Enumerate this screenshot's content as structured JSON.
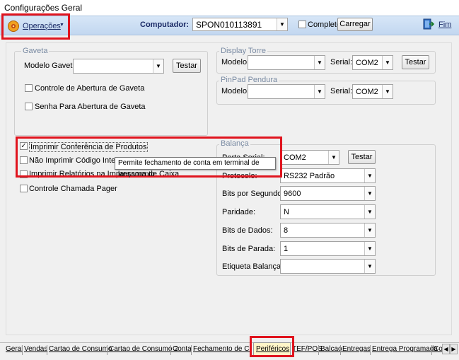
{
  "window": {
    "title": "Configurações Geral"
  },
  "toolbar": {
    "operations_label": "Operações",
    "computer_label": "Computador:",
    "computer_value": "SPON010113891",
    "complete_label": "Completo",
    "load_button": "Carregar",
    "exit_label": "Fim"
  },
  "gaveta": {
    "title": "Gaveta",
    "model_label": "Modelo Gaveta:",
    "model_value": "",
    "test_button": "Testar",
    "opening_control_label": "Controle de Abertura de Gaveta",
    "password_label": "Senha Para Abertura de Gaveta"
  },
  "display_torre": {
    "title": "Display Torre",
    "model_label": "Modelo:",
    "model_value": "",
    "serial_label": "Serial:",
    "serial_value": "COM2",
    "test_button": "Testar"
  },
  "pinpad": {
    "title": "PinPad Pendura",
    "model_label": "Modelo:",
    "model_value": "",
    "serial_label": "Serial:",
    "serial_value": "COM2"
  },
  "options": {
    "print_products_label": "Imprimir Conferência de Produtos",
    "print_products_checked": true,
    "no_internal_code_label": "Não Imprimir Código Interno no",
    "print_reports_label": "Imprimir Relatórios na Impressora de Caixa",
    "pager_label": "Controle Chamada Pager"
  },
  "tooltip": {
    "text": "Permite fechamento de conta em terminal de lançamento"
  },
  "balanca": {
    "title": "Balança",
    "serial_port_label": "Porta Serial:",
    "serial_port_value": "COM2",
    "test_button": "Testar",
    "protocol_label": "Protocolo:",
    "protocol_value": "RS232 Padrão",
    "bps_label": "Bits por Segundo:",
    "bps_value": "9600",
    "parity_label": "Paridade:",
    "parity_value": "N",
    "data_bits_label": "Bits de Dados:",
    "data_bits_value": "8",
    "stop_bits_label": "Bits de Parada:",
    "stop_bits_value": "1",
    "label_label": "Etiqueta Balança:",
    "label_value": ""
  },
  "tabs": [
    "Geral",
    "Vendas",
    "Cartao de Consumo",
    "Cartao de Consumo 2",
    "Conta",
    "Fechamento de Caixa",
    "Periféricos",
    "TEF/POS",
    "Balcao",
    "Entregas",
    "Entrega Programada",
    "Co"
  ],
  "active_tab": "Periféricos",
  "colors": {
    "highlight": "#e0141e",
    "toolbar_bg": "#c2d7f0"
  }
}
